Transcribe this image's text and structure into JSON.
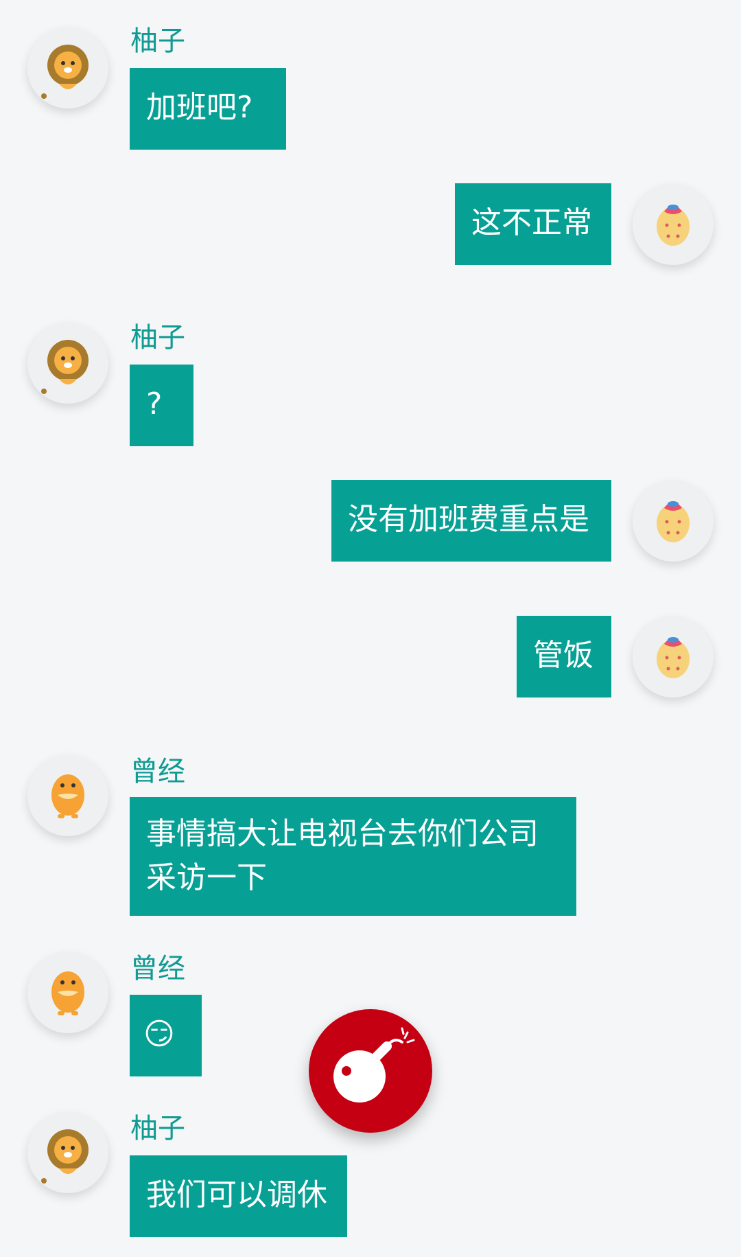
{
  "messages": [
    {
      "side": "left",
      "sender": "柚子",
      "avatar": "lion-avatar",
      "lines": [
        "加班吧?"
      ]
    },
    {
      "side": "right",
      "avatar": "egg-avatar",
      "lines": [
        "这不正常"
      ]
    },
    {
      "side": "left",
      "sender": "柚子",
      "avatar": "lion-avatar",
      "lines": [
        "?"
      ]
    },
    {
      "side": "right",
      "avatar": "egg-avatar",
      "lines": [
        "没有加班费重点是"
      ]
    },
    {
      "side": "right",
      "avatar": "egg-avatar",
      "lines": [
        "管饭"
      ]
    },
    {
      "side": "left",
      "sender": "曾经",
      "avatar": "duck-avatar",
      "lines": [
        "事情搞大让电视台去你们公司",
        "采访一下"
      ]
    },
    {
      "side": "left",
      "sender": "曾经",
      "avatar": "duck-avatar",
      "lines": [
        "😏"
      ]
    },
    {
      "side": "left",
      "sender": "柚子",
      "avatar": "lion-avatar",
      "lines": [
        "我们可以调休"
      ]
    }
  ],
  "floating_button": {
    "icon": "bomb-icon"
  },
  "colors": {
    "bubble": "#07a095",
    "sender_name": "#0f9a92",
    "background": "#f5f6f7",
    "bomb_button": "#c40012"
  }
}
